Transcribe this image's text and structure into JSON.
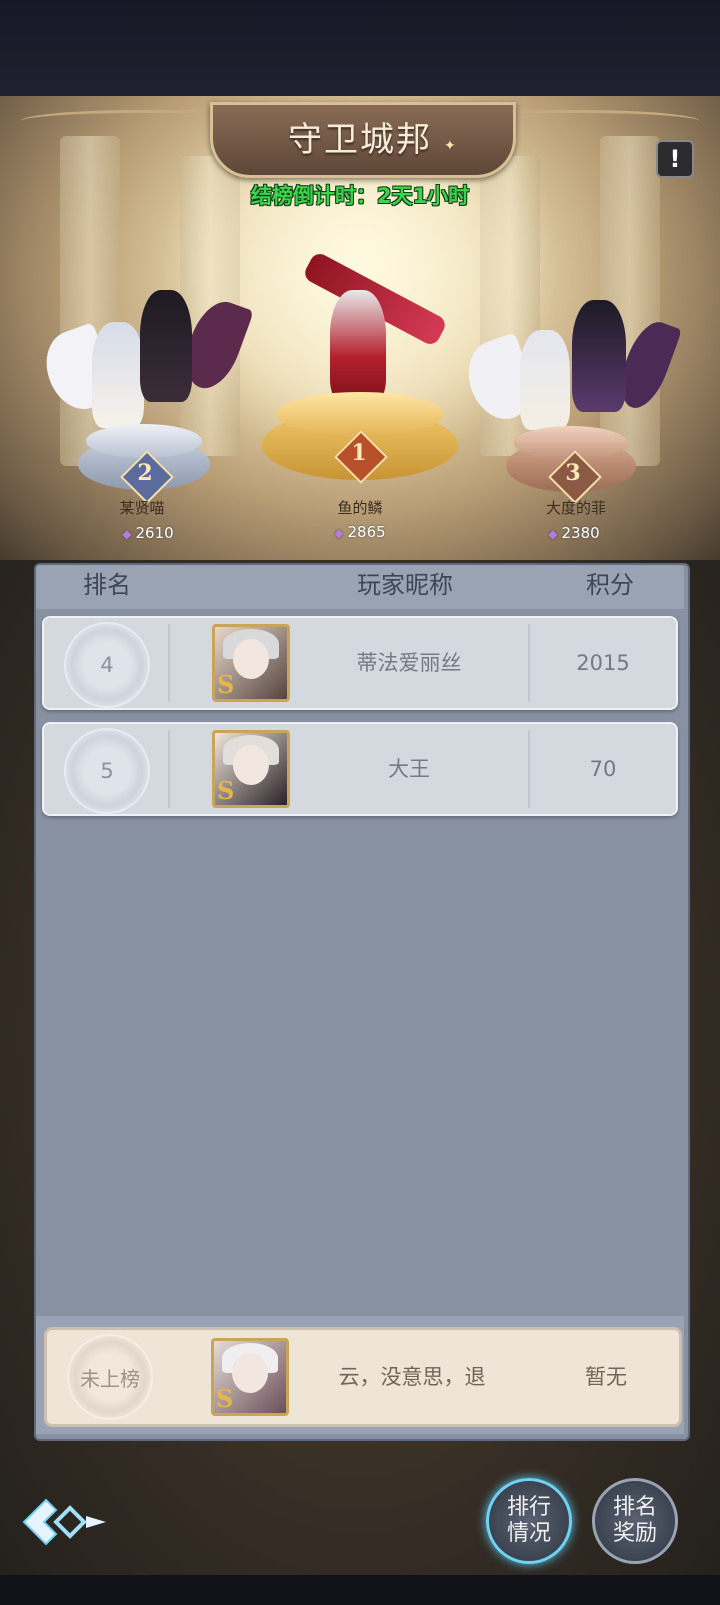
{
  "event": {
    "title": "守卫城邦",
    "countdown": "结榜倒计时：2天1小时",
    "info_icon": "exclamation-icon"
  },
  "podium": [
    {
      "rank": "1",
      "name": "鱼的鳞",
      "score": "2865"
    },
    {
      "rank": "2",
      "name": "某贤喵",
      "score": "2610"
    },
    {
      "rank": "3",
      "name": "大度的菲",
      "score": "2380"
    }
  ],
  "table": {
    "headers": {
      "rank": "排名",
      "nickname": "玩家昵称",
      "score": "积分"
    },
    "rows": [
      {
        "rank": "4",
        "name": "蒂法爱丽丝",
        "score": "2015"
      },
      {
        "rank": "5",
        "name": "大王",
        "score": "70"
      }
    ],
    "self": {
      "rank": "未上榜",
      "name": "云，没意思，退",
      "score": "暂无"
    }
  },
  "buttons": {
    "ranking_line1": "排行",
    "ranking_line2": "情况",
    "reward_line1": "排名",
    "reward_line2": "奖励"
  },
  "colors": {
    "countdown": "#3bd44c",
    "panel": "#8891a2",
    "active_button_glow": "#6fd2f2"
  }
}
